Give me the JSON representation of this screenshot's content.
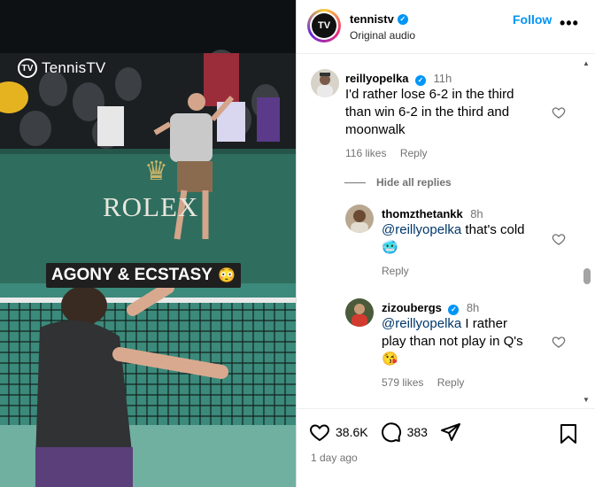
{
  "video": {
    "brand_logo_text": "TennisTV",
    "brand_logo_mark": "TV",
    "sponsor_text": "ROLEX",
    "caption_text": "AGONY & ECSTASY",
    "caption_emoji": "😳"
  },
  "header": {
    "username": "tennistv",
    "verified": true,
    "audio_label": "Original audio",
    "follow_label": "Follow",
    "more_label": "•••",
    "avatar_mark": "TV"
  },
  "comments": [
    {
      "username": "reillyopelka",
      "verified": true,
      "time": "11h",
      "lines": [
        "I'd rather lose 6-2 in the third",
        "than win 6-2 in the third and",
        "moonwalk"
      ],
      "likes": "116 likes",
      "reply_label": "Reply",
      "avatar_icon": "user-avatar-reillyopelka"
    }
  ],
  "hide_replies_label": "Hide all replies",
  "replies": [
    {
      "username": "thomzthetankk",
      "verified": false,
      "time": "8h",
      "mention": "@reillyopelka",
      "text": " that's cold",
      "emoji": "🥶",
      "likes": "",
      "reply_label": "Reply",
      "avatar_icon": "user-avatar-thomzthetankk"
    },
    {
      "username": "zizoubergs",
      "verified": true,
      "time": "8h",
      "mention": "@reillyopelka",
      "text": " I rather",
      "text2": "play than not play in Q's",
      "emoji": "😘",
      "likes": "579 likes",
      "reply_label": "Reply",
      "avatar_icon": "user-avatar-zizoubergs"
    }
  ],
  "footer": {
    "likes_count": "38.6K",
    "comments_count": "383",
    "posted_ago": "1 day ago"
  },
  "icons": {
    "like": "heart-icon",
    "comment": "comment-bubble-icon",
    "share": "paper-plane-icon",
    "save": "bookmark-icon",
    "verified": "verified-badge-icon"
  },
  "colors": {
    "accent_blue": "#0095f6",
    "mention": "#00376b",
    "muted": "#737373"
  }
}
